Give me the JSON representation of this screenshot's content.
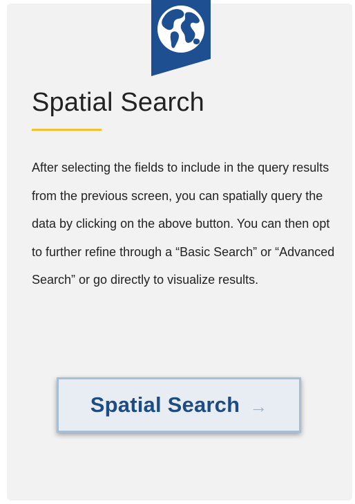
{
  "card": {
    "title": "Spatial Search",
    "description": "After selecting the fields to include in the query results from the previous screen, you can spatially query the data by clicking on the above button. You can then opt to further refine through a “Basic Search” or “Advanced Search” or go directly to visualize results.",
    "ribbon_icon": "globe-icon"
  },
  "cta": {
    "label": "Spatial Search",
    "arrow": "→",
    "arrow_icon": "arrow-right-icon"
  },
  "colors": {
    "card_background": "#f2f2f2",
    "ribbon_blue": "#1d4f91",
    "accent_yellow": "#f2c230",
    "button_text": "#1d4c82",
    "button_border": "#a4bfd6",
    "button_background": "#e8edf4"
  }
}
